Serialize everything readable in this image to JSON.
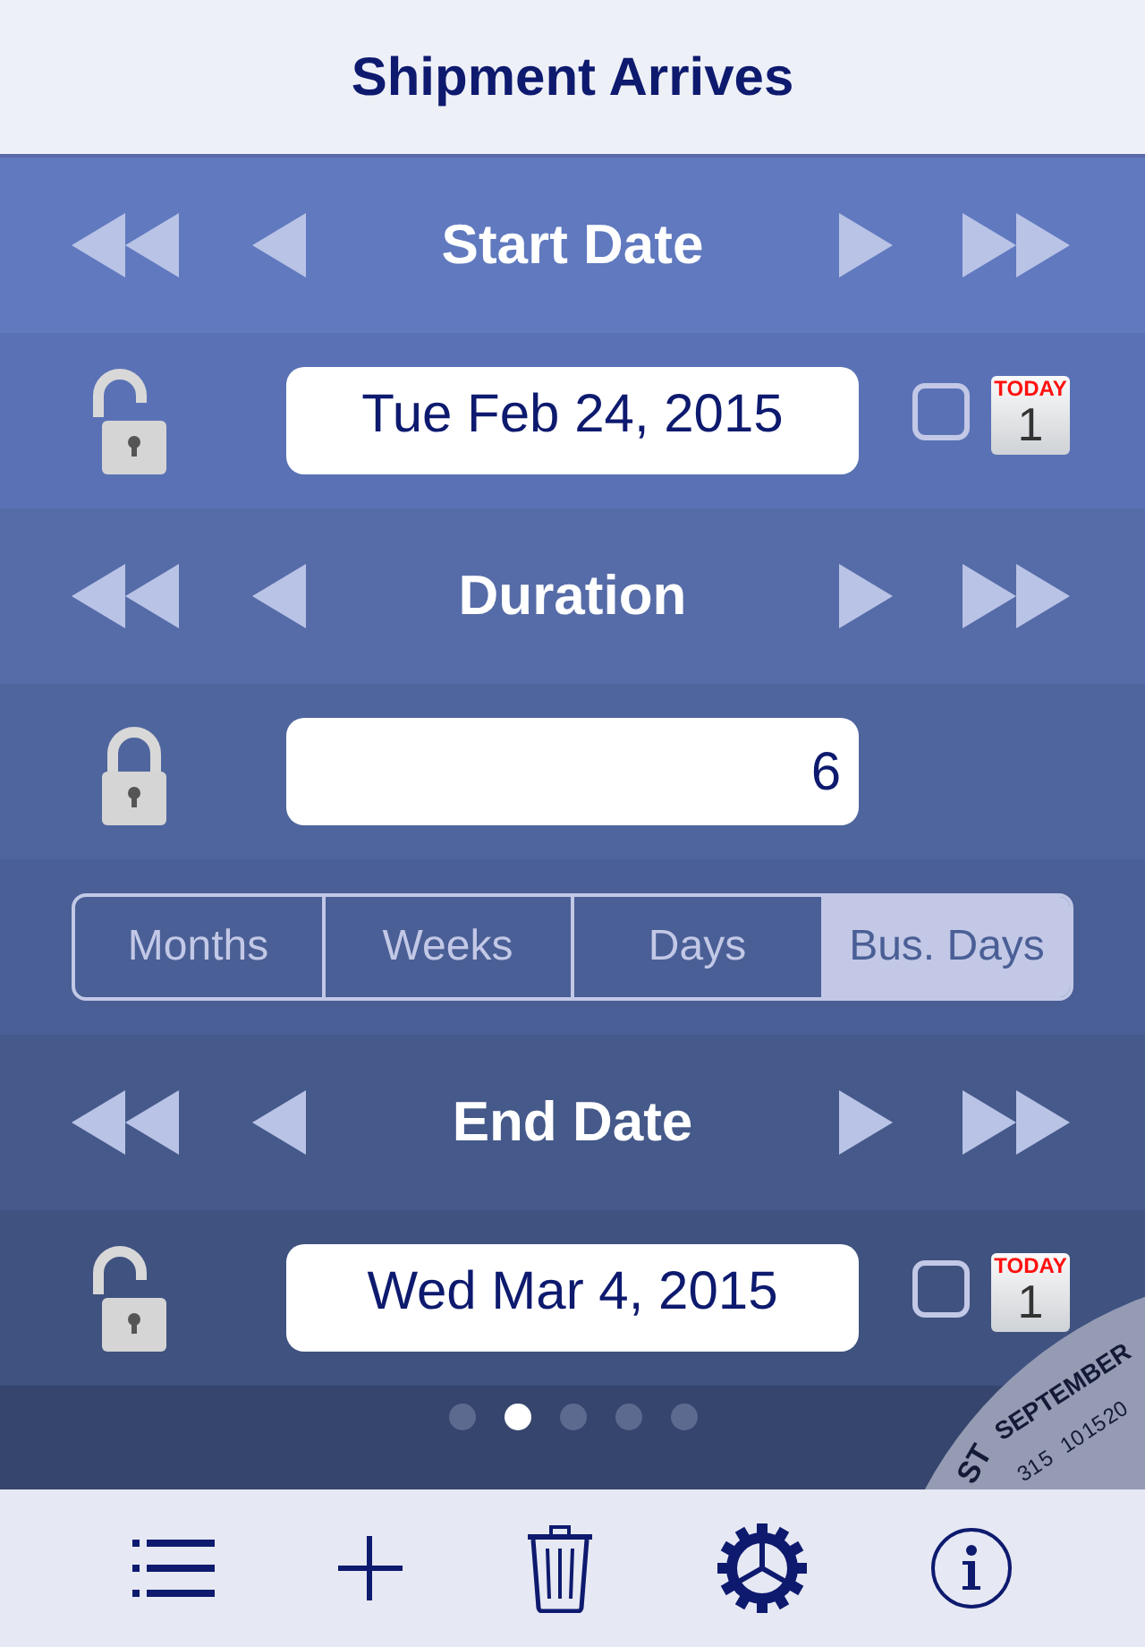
{
  "title": "Shipment Arrives",
  "sections": [
    {
      "kind": "nav",
      "label": "Start Date"
    },
    {
      "kind": "date",
      "locked": false,
      "value": "Tue Feb 24, 2015",
      "checked": false,
      "today_label": "TODAY",
      "today_day": "1"
    },
    {
      "kind": "nav",
      "label": "Duration"
    },
    {
      "kind": "number",
      "locked": true,
      "value": "6"
    },
    {
      "kind": "units",
      "options": [
        {
          "label": "Months",
          "selected": false
        },
        {
          "label": "Weeks",
          "selected": false
        },
        {
          "label": "Days",
          "selected": false
        },
        {
          "label": "Bus. Days",
          "selected": true
        }
      ]
    },
    {
      "kind": "nav",
      "label": "End Date"
    },
    {
      "kind": "date",
      "locked": false,
      "value": "Wed Mar 4, 2015",
      "checked": false,
      "today_label": "TODAY",
      "today_day": "1"
    }
  ],
  "pages": [
    {
      "selected": false
    },
    {
      "selected": true
    },
    {
      "selected": false
    },
    {
      "selected": false
    },
    {
      "selected": false
    }
  ],
  "dial": {
    "month": "SEPTEMBER",
    "prev_month": "ST",
    "numbers": [
      "31",
      "5",
      "10",
      "15",
      "20"
    ]
  },
  "toolbar": [
    {
      "kind": "list"
    },
    {
      "kind": "add"
    },
    {
      "kind": "trash"
    },
    {
      "kind": "settings"
    },
    {
      "kind": "info"
    }
  ]
}
